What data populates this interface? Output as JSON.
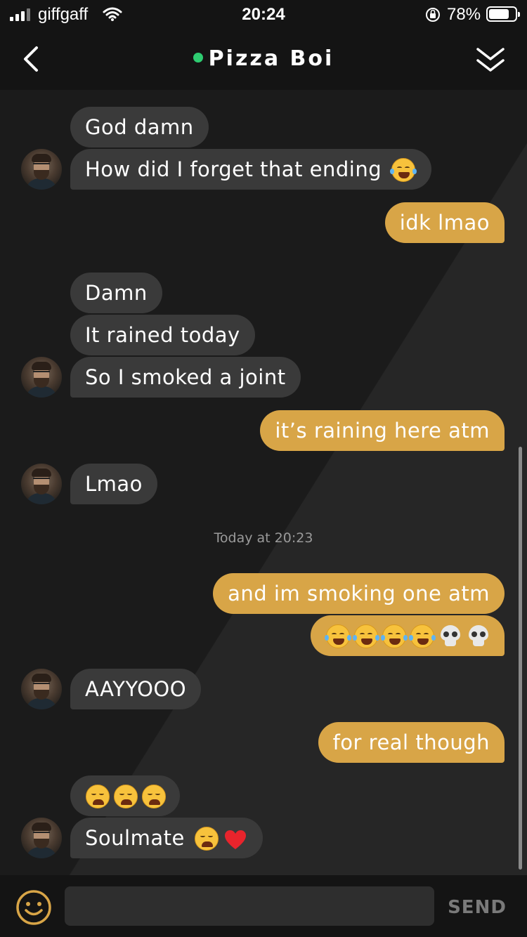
{
  "status_bar": {
    "carrier": "giffgaff",
    "time": "20:24",
    "battery": "78%",
    "icons": [
      "signal-icon",
      "wifi-icon",
      "orientation-lock-icon",
      "battery-icon"
    ]
  },
  "header": {
    "title": "Pizza Boi",
    "online": true,
    "online_color": "#2ecc71",
    "icons": [
      "chevron-left-icon",
      "double-chevron-down-icon"
    ]
  },
  "colors": {
    "incoming_bubble": "#3a3a3a",
    "outgoing_bubble": "#d8a547",
    "background": "#1e1e1e"
  },
  "messages": [
    {
      "from": "them",
      "text": "God damn"
    },
    {
      "from": "them",
      "text": "How did I forget that ending",
      "emoji": [
        "face-with-tears-of-joy"
      ]
    },
    {
      "from": "me",
      "text": "idk lmao"
    },
    {
      "from": "them",
      "text": "Damn"
    },
    {
      "from": "them",
      "text": "It rained today"
    },
    {
      "from": "them",
      "text": "So I smoked a joint"
    },
    {
      "from": "me",
      "text": "it’s raining here atm"
    },
    {
      "from": "them",
      "text": "Lmao"
    },
    {
      "from": "me",
      "text": "and im smoking one atm"
    },
    {
      "from": "me",
      "text": "",
      "emoji": [
        "loudly-crying-face",
        "loudly-crying-face",
        "loudly-crying-face",
        "loudly-crying-face",
        "skull",
        "skull"
      ]
    },
    {
      "from": "them",
      "text": "AAYYOOO"
    },
    {
      "from": "me",
      "text": "for real though"
    },
    {
      "from": "them",
      "text": "",
      "emoji": [
        "weary-face",
        "weary-face",
        "weary-face"
      ]
    },
    {
      "from": "them",
      "text": "Soulmate",
      "emoji": [
        "weary-face",
        "red-heart"
      ]
    }
  ],
  "timestamp": "Today at 20:23",
  "composer": {
    "placeholder": "",
    "send_label": "SEND",
    "icons": [
      "emoji-icon"
    ]
  }
}
